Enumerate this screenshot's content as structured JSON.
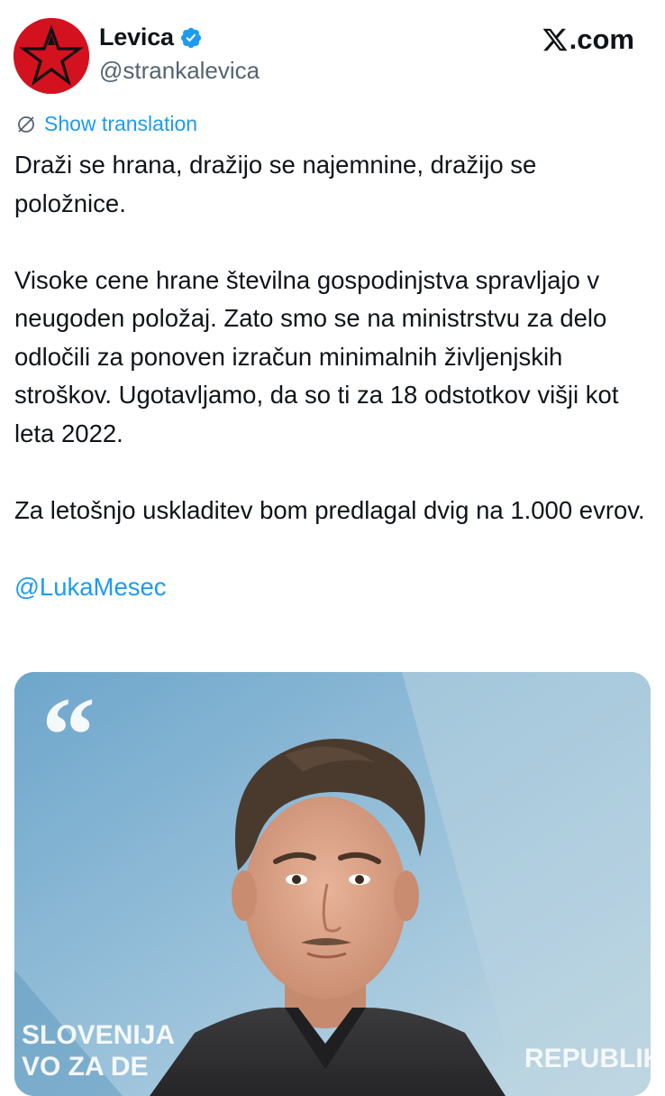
{
  "author": {
    "display_name": "Levica",
    "handle": "@strankalevica",
    "avatar_color": "#d4111e",
    "verified": true,
    "verified_color": "#1d9bf0"
  },
  "brand": {
    "label": ".com",
    "icon": "x-logo-icon"
  },
  "translate": {
    "label": "Show translation",
    "icon": "globe-icon",
    "color": "#1d9bf0"
  },
  "tweet": {
    "paragraphs": [
      "Draži se hrana, dražijo se najemnine, dražijo se položnice.",
      "Visoke cene hrane številna gospodinjstva spravljajo v neugoden položaj. Zato smo se na ministrstvu za delo odločili za ponoven izračun minimalnih življenjskih stroškov. Ugotavljamo, da so ti za 18 odstotkov višji kot leta 2022.",
      "Za letošnjo uskladitev bom predlagal dvig na 1.000 evrov."
    ],
    "mention": "@LukaMesec"
  },
  "media": {
    "quote_mark": "“",
    "backdrop_left_text": "SLOVENIJA",
    "backdrop_left_text_2": "VO ZA DE",
    "backdrop_right_text": "REPUBLIK",
    "background_color": "#7fb0cf"
  }
}
